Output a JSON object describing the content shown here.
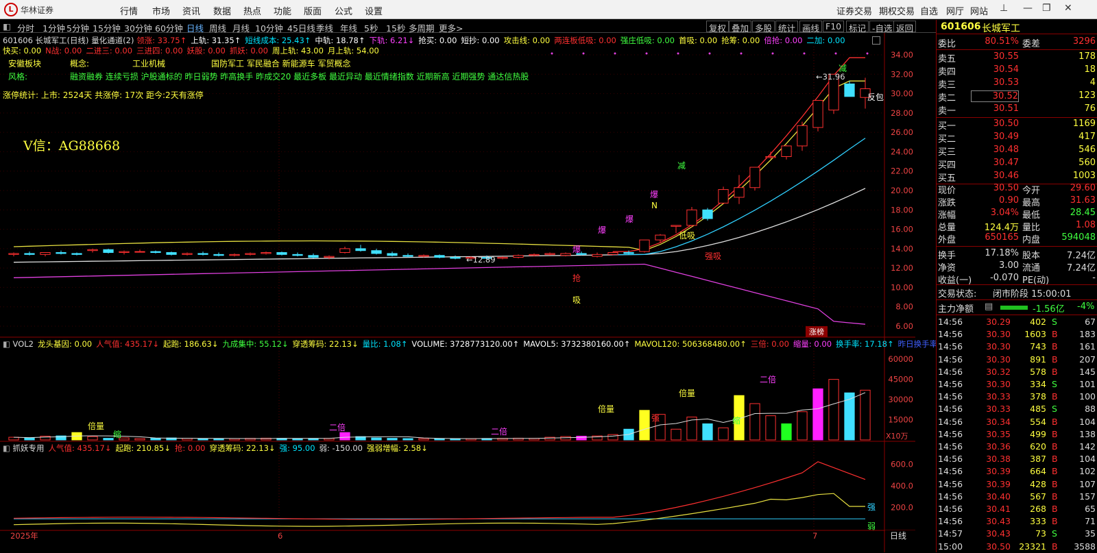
{
  "app": {
    "brand": "华林证券",
    "logo_char": "L"
  },
  "menu": [
    "行情",
    "市场",
    "资讯",
    "数据",
    "热点",
    "功能",
    "版面",
    "公式",
    "设置"
  ],
  "right_menu": [
    "证券交易",
    "期权交易",
    "自选",
    "网厅",
    "网站"
  ],
  "periods": [
    "分时",
    "1分钟",
    "5分钟",
    "15分钟",
    "30分钟",
    "60分钟",
    "日线",
    "周线",
    "月线",
    "10分钟",
    "45日线",
    "季线",
    "年线",
    "5秒",
    "15秒",
    "多周期",
    "更多>"
  ],
  "tools": [
    "复权",
    "叠加",
    "多股",
    "统计",
    "画线",
    "F10",
    "标记",
    "-自选",
    "返回"
  ],
  "main_header": {
    "code_name": "601606 长城军工(日线)",
    "ind": "量化通道(2)",
    "items": [
      {
        "t": "领涨: 33.75↑",
        "c": "#ff3030"
      },
      {
        "t": "上轨: 31.35↑",
        "c": "#ffffff"
      },
      {
        "t": "短线成本: 25.43↑",
        "c": "#00e5ff"
      },
      {
        "t": "中轨: 18.78↑",
        "c": "#ffffff"
      },
      {
        "t": "下轨: 6.21↓",
        "c": "#ff40ff"
      },
      {
        "t": "抢买: 0.00",
        "c": "#ffffff"
      },
      {
        "t": "短抄: 0.00",
        "c": "#ffffff"
      },
      {
        "t": "攻击线: 0.00",
        "c": "#ffff40"
      },
      {
        "t": "两连板低吸: 0.00",
        "c": "#ff3030"
      },
      {
        "t": "强庄低吸: 0.00",
        "c": "#40ff40"
      },
      {
        "t": "首吸: 0.00",
        "c": "#ffff40"
      },
      {
        "t": "抢筹: 0.00",
        "c": "#ffff40"
      },
      {
        "t": "倍抢: 0.00",
        "c": "#ff40ff"
      },
      {
        "t": "二加: 0.00",
        "c": "#00e5ff"
      }
    ],
    "line2": [
      {
        "t": "快买: 0.00",
        "c": "#ffff40"
      },
      {
        "t": "N战: 0.00",
        "c": "#ff3030"
      },
      {
        "t": "二进三: 0.00",
        "c": "#ff3030"
      },
      {
        "t": "三进四: 0.00",
        "c": "#ff3030"
      },
      {
        "t": "妖股: 0.00",
        "c": "#ff3030"
      },
      {
        "t": "抓妖: 0.00",
        "c": "#ff3030"
      },
      {
        "t": "周上轨: 43.00",
        "c": "#ffff40"
      },
      {
        "t": "月上轨: 54.00",
        "c": "#ffff40"
      }
    ]
  },
  "info": {
    "sector_label": "安徽板块",
    "concept_label": "概念:",
    "concept_val": "工业机械",
    "concept_tags": "国防军工 军民融合 新能源车 军贸概念",
    "style_label": "风格:",
    "style_val": "融资融券 连续亏损 沪股通标的 昨日弱势 昨高换手 昨成交20 最近多板 最近异动 最近情绪指数 近期新高 近期强势 通达信热股",
    "limit_stat": "涨停统计:  上市: 2524天  共涨停: 17次  距今:2天有涨停",
    "watermark": "V信：AG88668"
  },
  "price_axis": [
    "34.00",
    "32.00",
    "30.00",
    "28.00",
    "26.00",
    "24.00",
    "22.00",
    "20.00",
    "18.00",
    "16.00",
    "14.00",
    "12.00",
    "10.00",
    "8.00",
    "6.00"
  ],
  "chart_labels": {
    "high": "31.96",
    "low": "12.89",
    "reverse": "反包",
    "limit_board": "涨榜",
    "jian": "减",
    "qiang": "抢",
    "xi": "吸",
    "dixi": "低吸",
    "qiangxi": "强吸",
    "bao": "爆",
    "n": "N"
  },
  "chart_data": {
    "type": "candlestick",
    "ylim": [
      6,
      34
    ],
    "candles": [
      [
        13.4,
        13.6,
        13.2,
        13.5
      ],
      [
        13.5,
        13.7,
        13.3,
        13.4
      ],
      [
        13.4,
        13.6,
        13.2,
        13.6
      ],
      [
        13.6,
        13.8,
        13.4,
        13.5
      ],
      [
        13.5,
        13.6,
        13.3,
        13.4
      ],
      [
        13.8,
        14.0,
        13.6,
        13.9
      ],
      [
        13.9,
        14.0,
        13.5,
        13.6
      ],
      [
        13.6,
        13.8,
        13.4,
        13.7
      ],
      [
        13.7,
        13.9,
        13.6,
        13.7
      ],
      [
        13.7,
        13.8,
        13.5,
        13.6
      ],
      [
        13.6,
        13.7,
        13.3,
        13.4
      ],
      [
        13.4,
        13.6,
        13.3,
        13.5
      ],
      [
        13.5,
        13.7,
        13.3,
        13.4
      ],
      [
        13.4,
        13.6,
        13.2,
        13.3
      ],
      [
        13.3,
        13.5,
        13.2,
        13.4
      ],
      [
        13.4,
        13.6,
        13.3,
        13.5
      ],
      [
        13.5,
        13.7,
        13.4,
        13.6
      ],
      [
        13.6,
        13.7,
        13.3,
        13.4
      ],
      [
        13.4,
        13.6,
        13.2,
        13.3
      ],
      [
        13.3,
        13.5,
        13.0,
        13.1
      ],
      [
        13.1,
        13.3,
        12.9,
        13.2
      ],
      [
        13.6,
        14.2,
        13.5,
        14.0
      ],
      [
        14.0,
        14.4,
        13.7,
        13.8
      ],
      [
        13.8,
        14.0,
        13.4,
        13.5
      ],
      [
        13.5,
        13.7,
        13.2,
        13.3
      ],
      [
        13.3,
        13.5,
        13.1,
        13.2
      ],
      [
        13.2,
        13.4,
        13.1,
        13.3
      ],
      [
        13.3,
        13.4,
        13.0,
        13.1
      ],
      [
        13.1,
        13.3,
        12.9,
        13.0
      ],
      [
        13.0,
        13.2,
        12.9,
        13.1
      ],
      [
        13.1,
        13.3,
        12.89,
        13.0
      ],
      [
        13.0,
        13.2,
        12.9,
        13.1
      ],
      [
        13.1,
        13.4,
        13.0,
        13.3
      ],
      [
        13.3,
        13.5,
        13.2,
        13.4
      ],
      [
        13.4,
        13.6,
        13.3,
        13.5
      ],
      [
        13.3,
        13.6,
        13.2,
        13.5
      ],
      [
        13.5,
        13.7,
        13.3,
        13.4
      ],
      [
        13.2,
        13.6,
        13.1,
        13.4
      ],
      [
        13.4,
        13.7,
        13.3,
        13.6
      ],
      [
        13.6,
        13.8,
        13.4,
        13.5
      ],
      [
        13.7,
        14.9,
        13.6,
        14.9
      ],
      [
        14.9,
        15.5,
        14.6,
        15.4
      ],
      [
        16.3,
        16.4,
        15.6,
        16.4
      ],
      [
        16.4,
        18.3,
        16.2,
        18.0
      ],
      [
        18.0,
        18.2,
        16.9,
        17.1
      ],
      [
        18.7,
        20.4,
        18.6,
        20.1
      ],
      [
        19.3,
        21.6,
        18.6,
        20.3
      ],
      [
        20.3,
        22.4,
        20.0,
        22.4
      ],
      [
        23.4,
        24.0,
        23.3,
        23.5
      ],
      [
        23.5,
        24.7,
        23.2,
        24.6
      ],
      [
        24.6,
        27.1,
        24.1,
        26.7
      ],
      [
        26.5,
        29.3,
        26.1,
        29.3
      ],
      [
        28.3,
        31.96,
        27.9,
        32.0
      ],
      [
        31.0,
        31.3,
        29.7,
        29.7
      ],
      [
        29.6,
        31.63,
        28.45,
        30.5
      ]
    ],
    "closes_ma_white": "line",
    "vol_axis": [
      "60000",
      "45000",
      "30000",
      "15000"
    ],
    "vol_unit": "X10万",
    "ind_axis": [
      "600.0",
      "400.0",
      "200.0"
    ]
  },
  "vol_header": [
    {
      "t": "VOL2",
      "c": "#dddddd"
    },
    {
      "t": "龙头基因: 0.00",
      "c": "#ffff40"
    },
    {
      "t": "人气值: 435.17↓",
      "c": "#ff3030"
    },
    {
      "t": "起跑: 186.63↓",
      "c": "#ffff40"
    },
    {
      "t": "九成集中: 55.12↓",
      "c": "#40ff40"
    },
    {
      "t": "穿透筹码: 22.13↓",
      "c": "#ffff40"
    },
    {
      "t": "量比: 1.08↑",
      "c": "#00e5ff"
    },
    {
      "t": "VOLUME: 3728773120.00↑",
      "c": "#ffffff"
    },
    {
      "t": "MAVOL5: 3732380160.00↑",
      "c": "#ffffff"
    },
    {
      "t": "MAVOL120: 506368480.00↑",
      "c": "#ffff40"
    },
    {
      "t": "三倍: 0.00",
      "c": "#ff3030"
    },
    {
      "t": "缩量: 0.00",
      "c": "#ff40ff"
    },
    {
      "t": "换手率: 17.18↑",
      "c": "#00e5ff"
    },
    {
      "t": "昨日换手率",
      "c": "#4060ff"
    }
  ],
  "ind_header": [
    {
      "t": "抓妖专用",
      "c": "#dddddd"
    },
    {
      "t": "人气值: 435.17↓",
      "c": "#ff3030"
    },
    {
      "t": "起跑: 210.85↓",
      "c": "#ffff40"
    },
    {
      "t": "抢: 0.00",
      "c": "#ff3030"
    },
    {
      "t": "穿透筹码: 22.13↓",
      "c": "#ffff40"
    },
    {
      "t": "强: 95.00",
      "c": "#00e5ff"
    },
    {
      "t": "弱: -150.00",
      "c": "#dddddd"
    },
    {
      "t": "强弱增幅: 2.58↓",
      "c": "#ffff40"
    }
  ],
  "vol_labels": {
    "bei": "倍量",
    "suo": "缩",
    "er": "二倍",
    "qiang": "强",
    "ruo": "弱"
  },
  "dates": [
    "2025年",
    "6",
    "7"
  ],
  "period_tag": "日线",
  "quote": {
    "code": "601606",
    "name": "长城军工",
    "webi_label": "委比",
    "webi": "80.51%",
    "wecha_label": "委差",
    "wecha": "3296",
    "asks": [
      {
        "l": "卖五",
        "p": "30.55",
        "v": "178"
      },
      {
        "l": "卖四",
        "p": "30.54",
        "v": "18"
      },
      {
        "l": "卖三",
        "p": "30.53",
        "v": "4"
      },
      {
        "l": "卖二",
        "p": "30.52",
        "v": "123"
      },
      {
        "l": "卖一",
        "p": "30.51",
        "v": "76"
      }
    ],
    "bids": [
      {
        "l": "买一",
        "p": "30.50",
        "v": "1169"
      },
      {
        "l": "买二",
        "p": "30.49",
        "v": "417"
      },
      {
        "l": "买三",
        "p": "30.48",
        "v": "546"
      },
      {
        "l": "买四",
        "p": "30.47",
        "v": "560"
      },
      {
        "l": "买五",
        "p": "30.46",
        "v": "1003"
      }
    ],
    "stats": [
      [
        "现价",
        "30.50",
        "今开",
        "29.60"
      ],
      [
        "涨跌",
        "0.90",
        "最高",
        "31.63"
      ],
      [
        "涨幅",
        "3.04%",
        "最低",
        "28.45"
      ],
      [
        "总量",
        "124.4万",
        "量比",
        "1.08"
      ],
      [
        "外盘",
        "650165",
        "内盘",
        "594048"
      ],
      [
        "换手",
        "17.18%",
        "股本",
        "7.24亿"
      ],
      [
        "净资",
        "3.00",
        "流通",
        "7.24亿"
      ],
      [
        "收益(一)",
        "-0.070",
        "PE(动)",
        "-"
      ]
    ],
    "status_label": "交易状态:",
    "status": "闭市阶段 15:00:01",
    "flow_label": "主力净额",
    "flow": "-1.56亿",
    "flow_pct": "-4%",
    "ticks": [
      [
        "14:56",
        "30.29",
        "402",
        "S",
        "67"
      ],
      [
        "14:56",
        "30.30",
        "1603",
        "B",
        "183"
      ],
      [
        "14:56",
        "30.30",
        "743",
        "B",
        "161"
      ],
      [
        "14:56",
        "30.30",
        "891",
        "B",
        "207"
      ],
      [
        "14:56",
        "30.32",
        "578",
        "B",
        "145"
      ],
      [
        "14:56",
        "30.30",
        "334",
        "S",
        "101"
      ],
      [
        "14:56",
        "30.33",
        "378",
        "B",
        "100"
      ],
      [
        "14:56",
        "30.33",
        "485",
        "S",
        "88"
      ],
      [
        "14:56",
        "30.34",
        "554",
        "B",
        "104"
      ],
      [
        "14:56",
        "30.35",
        "499",
        "B",
        "138"
      ],
      [
        "14:56",
        "30.36",
        "620",
        "B",
        "142"
      ],
      [
        "14:56",
        "30.38",
        "387",
        "B",
        "104"
      ],
      [
        "14:56",
        "30.39",
        "664",
        "B",
        "102"
      ],
      [
        "14:56",
        "30.39",
        "428",
        "B",
        "107"
      ],
      [
        "14:56",
        "30.40",
        "567",
        "B",
        "157"
      ],
      [
        "14:56",
        "30.41",
        "268",
        "B",
        "65"
      ],
      [
        "14:56",
        "30.43",
        "333",
        "B",
        "71"
      ],
      [
        "14:57",
        "30.43",
        "73",
        "S",
        "35"
      ],
      [
        "15:00",
        "30.50",
        "23321",
        "B",
        "3588"
      ]
    ]
  }
}
